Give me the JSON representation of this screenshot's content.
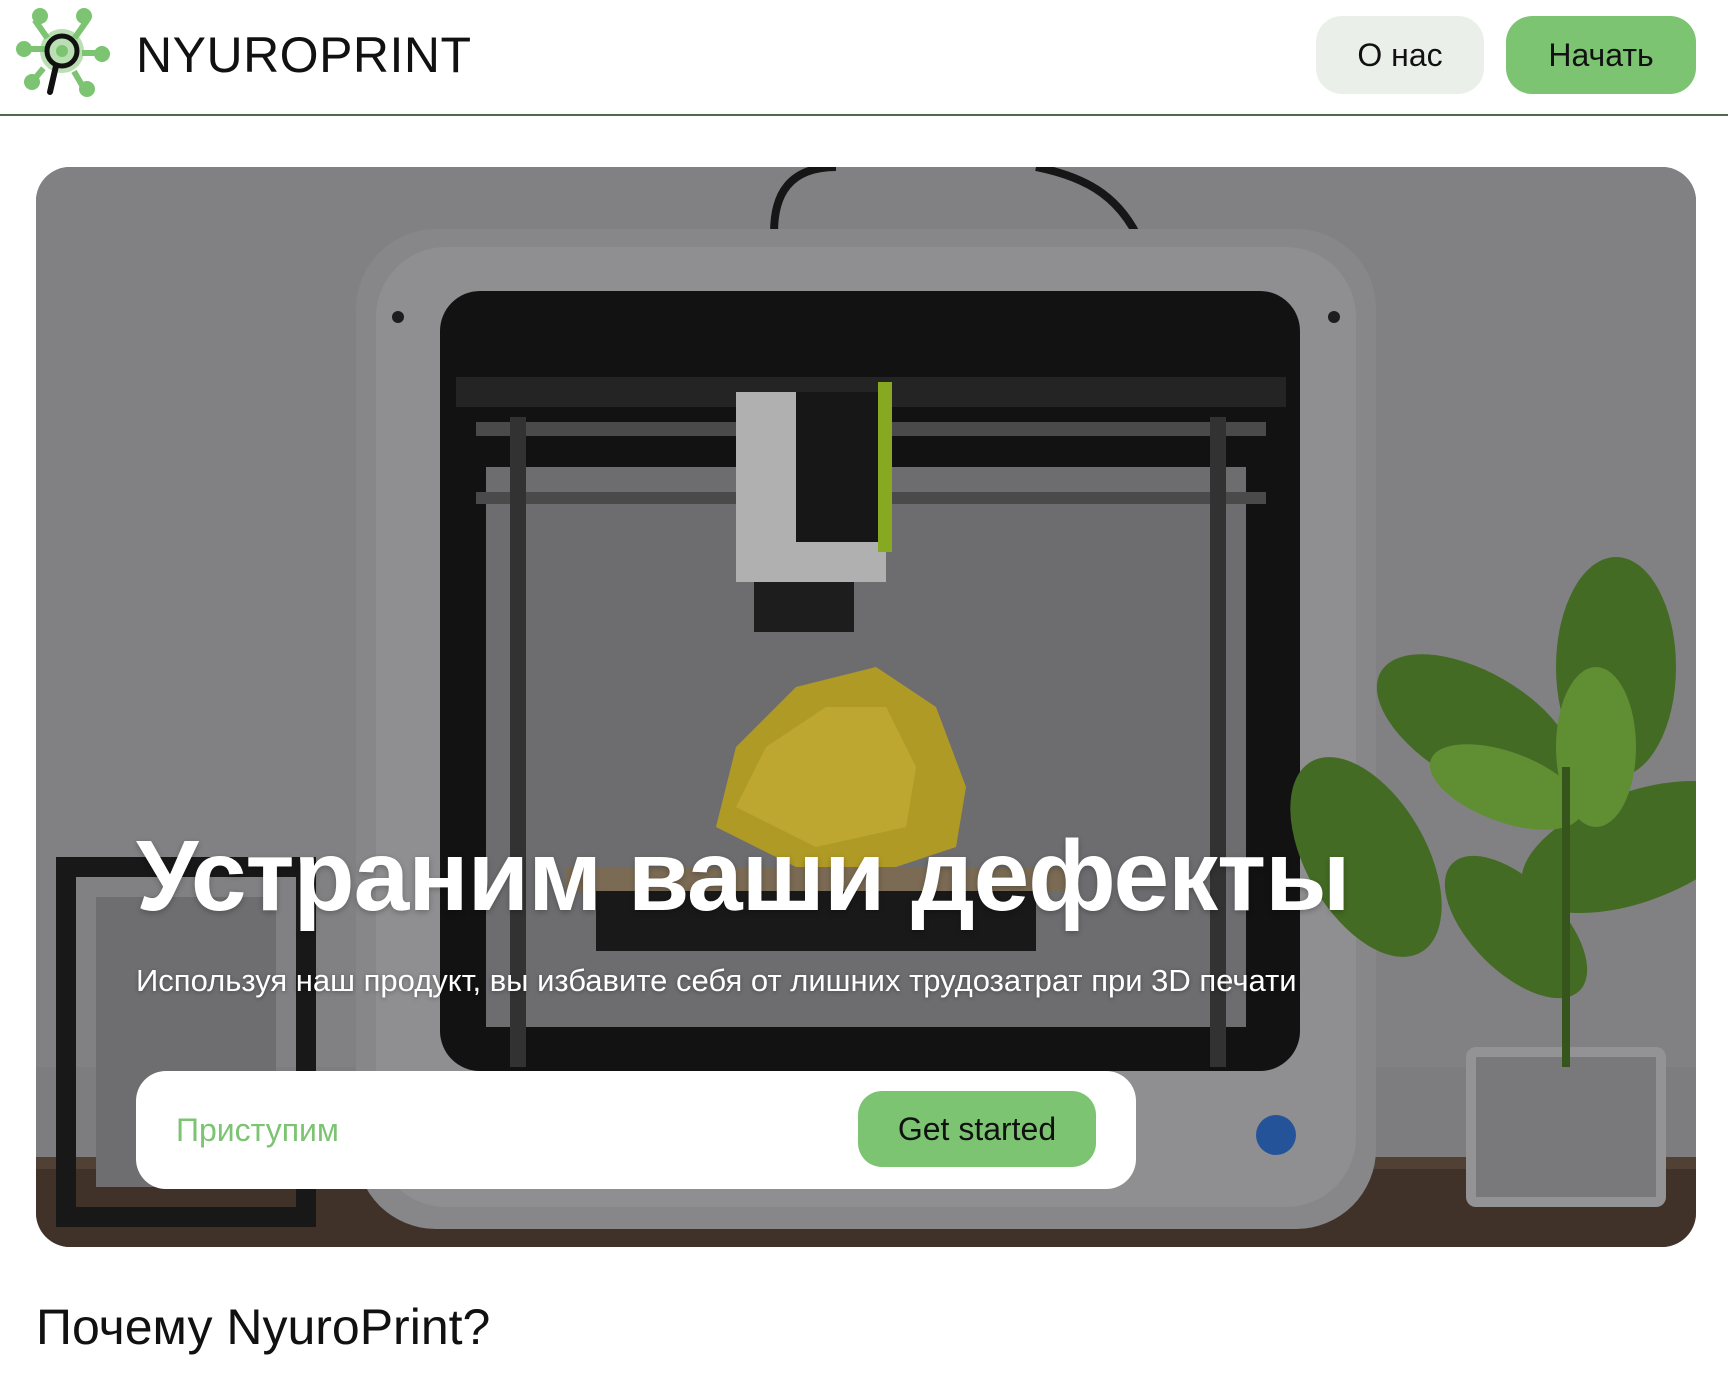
{
  "header": {
    "brand": "NYUROPRINT",
    "logo_icon": "neural-bug-logo-icon",
    "nav": {
      "about_label": "О нас",
      "start_label": "Начать"
    }
  },
  "hero": {
    "image": "3d-printer-photo",
    "title": "Устраним ваши дефекты",
    "subtitle": "Используя наш продукт, вы избавите себя от лишних трудозатрат при 3D печати",
    "cta": {
      "placeholder": "Приступим",
      "value": "",
      "button_label": "Get started"
    }
  },
  "section": {
    "title": "Почему NyuroPrint?"
  },
  "colors": {
    "accent": "#7cc472",
    "accent_light": "#eaf0e9",
    "header_border": "#4f6b4b",
    "text": "#111111"
  }
}
